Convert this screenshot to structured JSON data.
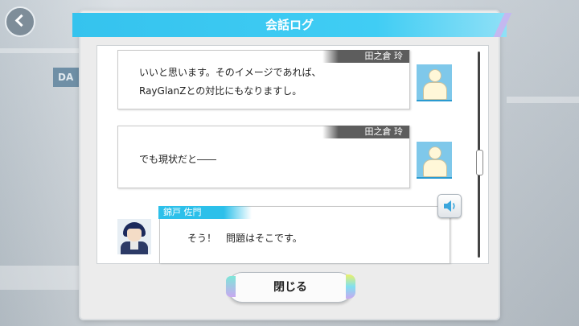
{
  "dialog": {
    "title": "会話ログ"
  },
  "messages": [
    {
      "speaker": "田之倉 玲",
      "line1": "いいと思います。そのイメージであれば、",
      "line2": "RayGlanZとの対比にもなりますし。"
    },
    {
      "speaker": "田之倉 玲",
      "line1": "でも現状だと――"
    },
    {
      "speaker": "錦戸 佐門",
      "line1": "そう！　問題はそこです。"
    }
  ],
  "buttons": {
    "close": "閉じる"
  },
  "background": {
    "tab_label": "DA"
  },
  "icons": {
    "back": "back-arrow-icon",
    "placeholder_avatar": "user-silhouette-icon",
    "voice": "speaker-icon"
  },
  "colors": {
    "accent": "#35c3ee",
    "speaker_tag": "#5d5d5d",
    "avatar_bg": "#7fc8ea"
  }
}
